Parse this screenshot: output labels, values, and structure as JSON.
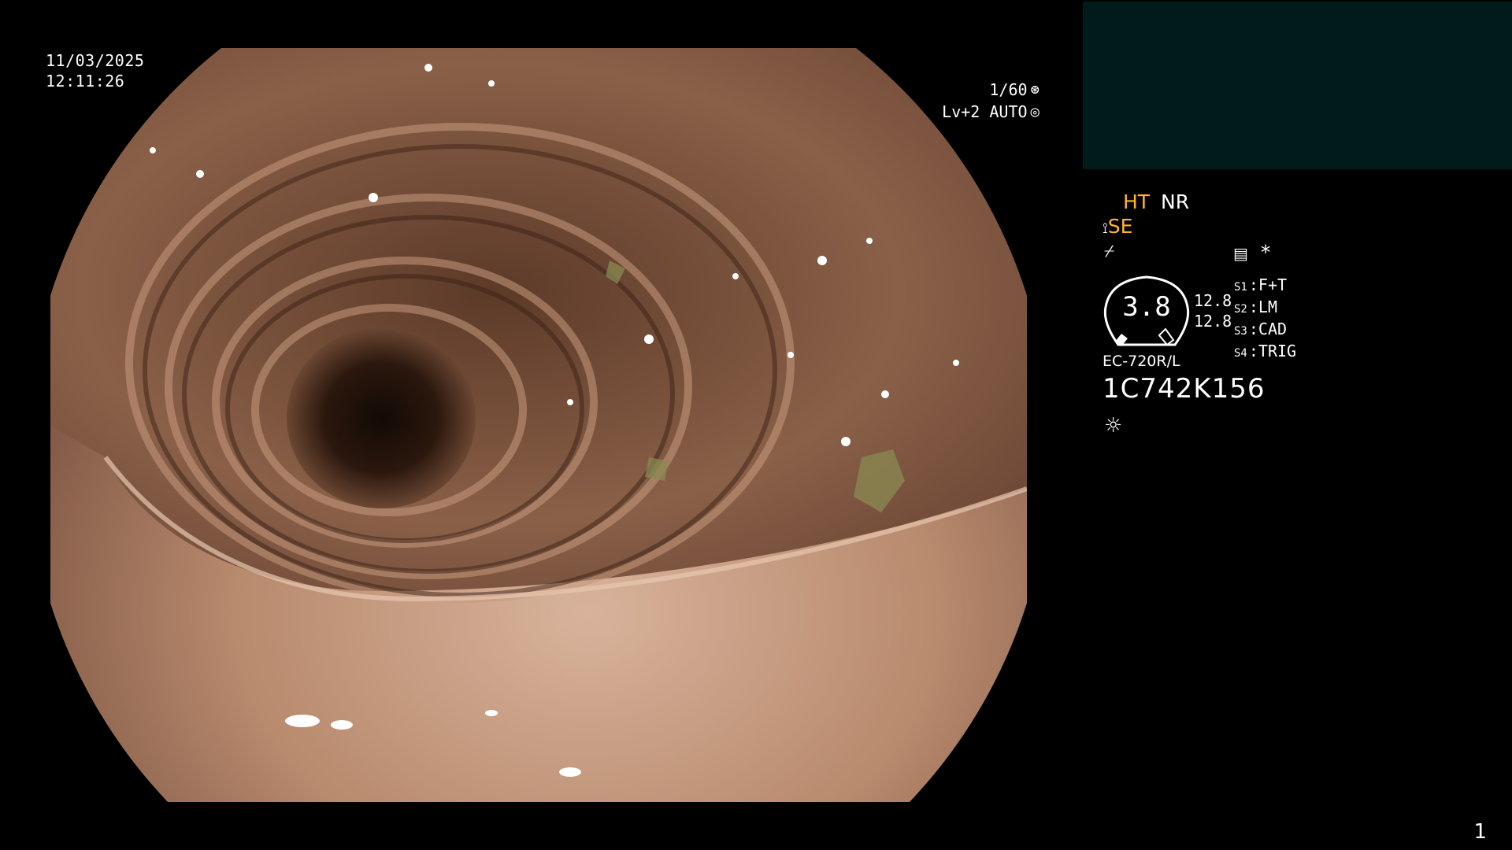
{
  "datetime": {
    "date": "11/03/2025",
    "time": "12:11:26"
  },
  "exposure": {
    "shutter": "1/60",
    "level": "Lv+2 AUTO"
  },
  "modes": {
    "ht": "HT",
    "nr": "NR",
    "se": "SE"
  },
  "gauge": {
    "value": "3.8",
    "ratio_top": "12.8",
    "ratio_bottom": "12.8"
  },
  "slots": [
    {
      "key": "S1",
      "value": "F+T"
    },
    {
      "key": "S2",
      "value": "LM"
    },
    {
      "key": "S3",
      "value": "CAD"
    },
    {
      "key": "S4",
      "value": "TRIG"
    }
  ],
  "scope": {
    "model": "EC-720R/L",
    "serial": "1C742K156"
  },
  "page_number": "1",
  "icons": [
    "shutter-aperture-icon",
    "auto-iris-icon",
    "structure-enhance-icon",
    "freeze-icon",
    "memo-icon",
    "asterisk-icon",
    "light-icon"
  ],
  "colors": {
    "accent": "#ffb52e",
    "thumbnail_bg": "#011a1a"
  }
}
